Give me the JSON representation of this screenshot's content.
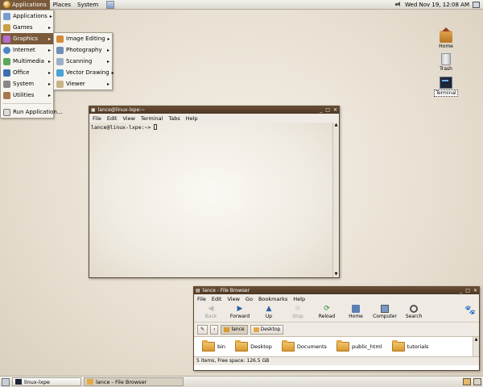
{
  "top_panel": {
    "menus": [
      "Applications",
      "Places",
      "System"
    ],
    "clock": "Wed Nov 19, 12:08 AM"
  },
  "applications_menu": {
    "items": [
      {
        "label": "Applications",
        "icon": "applications-icon"
      },
      {
        "label": "Games",
        "icon": "games-icon"
      },
      {
        "label": "Graphics",
        "icon": "graphics-icon"
      },
      {
        "label": "Internet",
        "icon": "internet-icon"
      },
      {
        "label": "Multimedia",
        "icon": "multimedia-icon"
      },
      {
        "label": "Office",
        "icon": "office-icon"
      },
      {
        "label": "System",
        "icon": "system-icon"
      },
      {
        "label": "Utilities",
        "icon": "utilities-icon"
      }
    ],
    "run": "Run Application..."
  },
  "graphics_submenu": {
    "items": [
      "Image Editing",
      "Photography",
      "Scanning",
      "Vector Drawing",
      "Viewer"
    ]
  },
  "desktop_icons": {
    "home": "Home",
    "trash": "Trash",
    "terminal": "Terminal"
  },
  "terminal": {
    "title": "lance@linux-lxpe:~",
    "menu": [
      "File",
      "Edit",
      "View",
      "Terminal",
      "Tabs",
      "Help"
    ],
    "prompt": "lance@linux-lxpe:~> "
  },
  "file_browser": {
    "title": "lance - File Browser",
    "menu": [
      "File",
      "Edit",
      "View",
      "Go",
      "Bookmarks",
      "Help"
    ],
    "toolbar": {
      "back": "Back",
      "forward": "Forward",
      "up": "Up",
      "stop": "Stop",
      "reload": "Reload",
      "home": "Home",
      "computer": "Computer",
      "search": "Search"
    },
    "path": [
      "lance",
      "Desktop"
    ],
    "files": [
      "bin",
      "Desktop",
      "Documents",
      "public_html",
      "tutorials"
    ],
    "status": "5 items, Free space: 126.5 GB"
  },
  "taskbar": {
    "tasks": [
      "linux-lxpe",
      "lance - File Browser"
    ]
  },
  "colors": {
    "accent": "#7a5a3a",
    "titlebar": "#5a4330",
    "folder": "#e3a846"
  }
}
